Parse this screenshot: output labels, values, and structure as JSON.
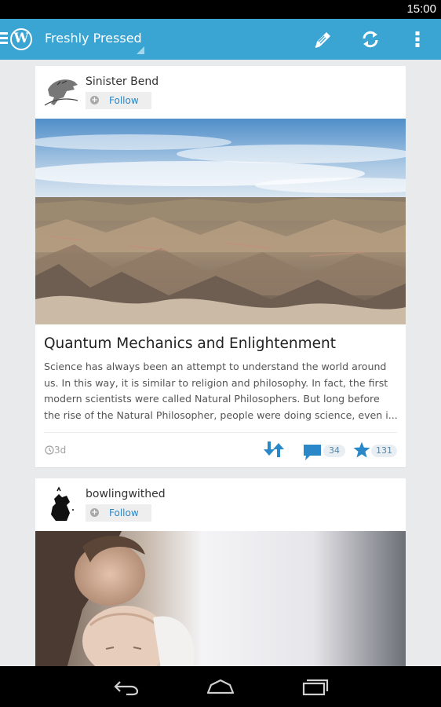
{
  "status_bar": {
    "time": "15:00"
  },
  "action_bar": {
    "title": "Freshly Pressed",
    "icons": [
      "menu-icon",
      "wordpress-logo-icon",
      "edit-icon",
      "refresh-icon",
      "overflow-menu-icon"
    ],
    "accent_color": "#3aa4d2"
  },
  "posts": [
    {
      "blog_name": "Sinister Bend",
      "follow_label": "Follow",
      "title": "Quantum Mechanics and Enlightenment",
      "excerpt_lines": [
        "Science has always been an attempt to understand the world around",
        "us. In this way, it is similar to religion and philosophy. In fact, the first",
        "modern scientists were called Natural Philosophers. But long before",
        "the rise of the Natural Philosopher, people were doing science, even i..."
      ],
      "age": "3d",
      "comment_count": "34",
      "like_count": "131"
    },
    {
      "blog_name": "bowlingwithed",
      "follow_label": "Follow"
    }
  ],
  "nav_bar": {
    "icons": [
      "back-icon",
      "home-icon",
      "recent-apps-icon"
    ]
  }
}
